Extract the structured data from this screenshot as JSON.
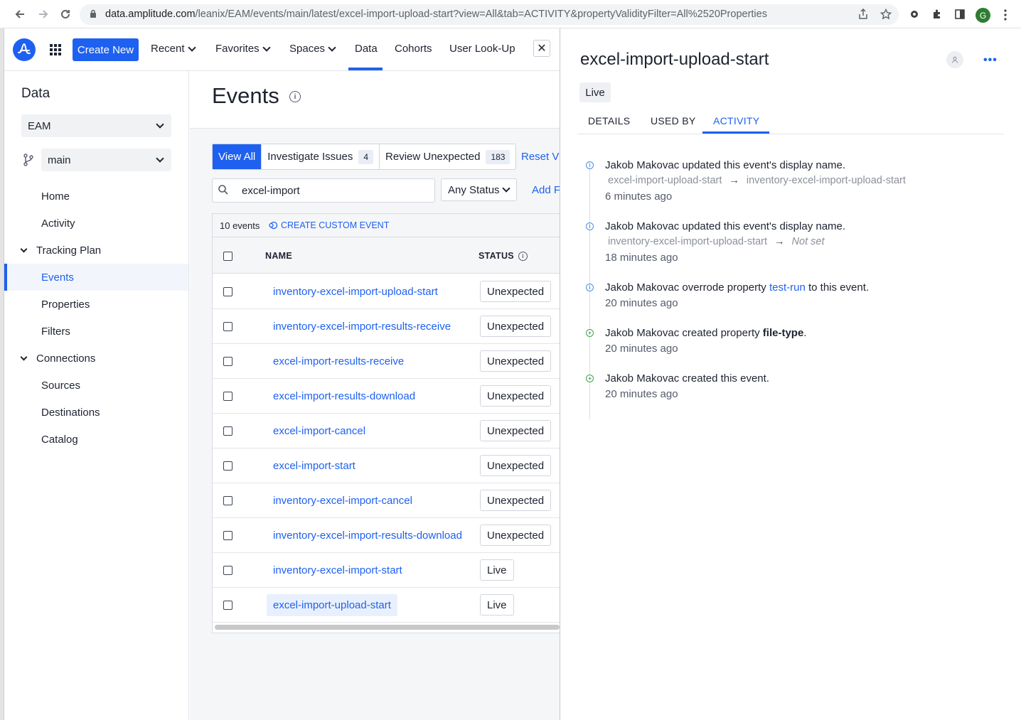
{
  "browser": {
    "url_host": "data.amplitude.com",
    "url_path": "/leanix/EAM/events/main/latest/excel-import-upload-start?view=All&tab=ACTIVITY&propertyValidityFilter=All%2520Properties",
    "avatar_letter": "G"
  },
  "header": {
    "create_new": "Create New",
    "nav": [
      "Recent",
      "Favorites",
      "Spaces",
      "Data",
      "Cohorts",
      "User Look-Up"
    ],
    "active_nav": "Data",
    "close_symbol": "✕"
  },
  "sidebar": {
    "title": "Data",
    "project": "EAM",
    "branch": "main",
    "links_top": [
      "Home",
      "Activity"
    ],
    "tracking_plan": "Tracking Plan",
    "tracking_items": [
      "Events",
      "Properties",
      "Filters"
    ],
    "connections": "Connections",
    "connection_items": [
      "Sources",
      "Destinations",
      "Catalog"
    ],
    "active": "Events"
  },
  "main": {
    "title": "Events",
    "tabs": [
      {
        "label": "View All",
        "count": ""
      },
      {
        "label": "Investigate Issues",
        "count": "4"
      },
      {
        "label": "Review Unexpected",
        "count": "183"
      }
    ],
    "reset_view": "Reset Vi",
    "search_value": "excel-import",
    "status_filter": "Any Status",
    "add_filter": "Add F",
    "event_count": "10 events",
    "create_custom": "CREATE CUSTOM EVENT",
    "columns": [
      "NAME",
      "STATUS"
    ],
    "rows": [
      {
        "name": "inventory-excel-import-upload-start",
        "status": "Unexpected"
      },
      {
        "name": "inventory-excel-import-results-receive",
        "status": "Unexpected"
      },
      {
        "name": "excel-import-results-receive",
        "status": "Unexpected"
      },
      {
        "name": "excel-import-results-download",
        "status": "Unexpected"
      },
      {
        "name": "excel-import-cancel",
        "status": "Unexpected"
      },
      {
        "name": "excel-import-start",
        "status": "Unexpected"
      },
      {
        "name": "inventory-excel-import-cancel",
        "status": "Unexpected"
      },
      {
        "name": "inventory-excel-import-results-download",
        "status": "Unexpected"
      },
      {
        "name": "inventory-excel-import-start",
        "status": "Live"
      },
      {
        "name": "excel-import-upload-start",
        "status": "Live"
      }
    ]
  },
  "panel": {
    "title": "excel-import-upload-start",
    "status": "Live",
    "tabs": [
      "DETAILS",
      "USED BY",
      "ACTIVITY"
    ],
    "active_tab": "ACTIVITY",
    "activity": [
      {
        "type": "info",
        "user": "Jakob Makovac",
        "text": " updated this event's display name.",
        "from": "excel-import-upload-start",
        "to": "inventory-excel-import-upload-start",
        "time": "6 minutes ago"
      },
      {
        "type": "info",
        "user": "Jakob Makovac",
        "text": " updated this event's display name.",
        "from": "inventory-excel-import-upload-start",
        "to": "Not set",
        "time": "18 minutes ago"
      },
      {
        "type": "info",
        "user": "Jakob Makovac",
        "text_a": " overrode property ",
        "link": "test-run",
        "text_b": " to this event.",
        "time": "20 minutes ago"
      },
      {
        "type": "add",
        "user": "Jakob Makovac",
        "text_a": " created property ",
        "strong": "file-type",
        "text_b": ".",
        "time": "20 minutes ago"
      },
      {
        "type": "add",
        "user": "Jakob Makovac",
        "text": " created this event.",
        "time": "20 minutes ago"
      }
    ]
  }
}
